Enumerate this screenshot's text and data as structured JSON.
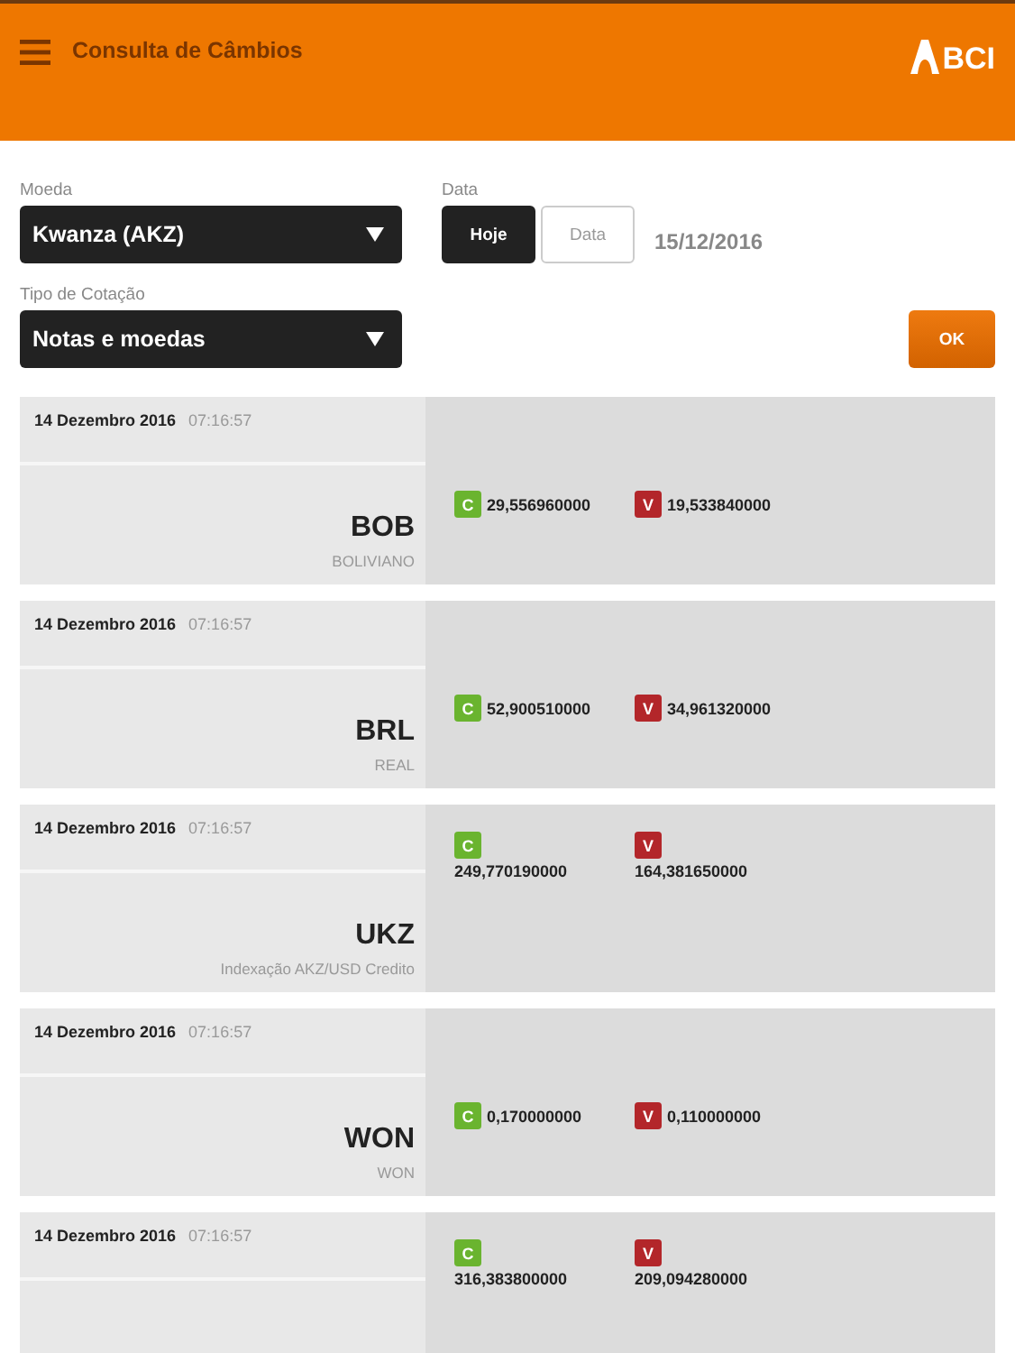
{
  "header": {
    "title": "Consulta de Câmbios",
    "logo": "BCI"
  },
  "form": {
    "currency": {
      "label": "Moeda",
      "value": "Kwanza (AKZ)"
    },
    "date": {
      "label": "Data",
      "options": [
        {
          "label": "Hoje",
          "selected": true
        },
        {
          "label": "Data",
          "selected": false
        }
      ],
      "value": "15/12/2016"
    },
    "quote_type": {
      "label": "Tipo de Cotação",
      "value": "Notas e moedas"
    },
    "ok_button": "OK"
  },
  "rates": [
    {
      "date": "14 Dezembro 2016",
      "time": "07:16:57",
      "code": "BOB",
      "name": "BOLIVIANO",
      "kind": "inline",
      "buy_badge": "C",
      "buy": "29,556960000",
      "sell_badge": "V",
      "sell": "19,533840000"
    },
    {
      "date": "14 Dezembro 2016",
      "time": "07:16:57",
      "code": "BRL",
      "name": "REAL",
      "kind": "inline",
      "buy_badge": "C",
      "buy": "52,900510000",
      "sell_badge": "V",
      "sell": "34,961320000"
    },
    {
      "date": "14 Dezembro 2016",
      "time": "07:16:57",
      "code": "UKZ",
      "name": "Indexação AKZ/USD Credito",
      "kind": "stacked",
      "buy_badge": "C",
      "buy": "249,770190000",
      "sell_badge": "V",
      "sell": "164,381650000"
    },
    {
      "date": "14 Dezembro 2016",
      "time": "07:16:57",
      "code": "WON",
      "name": "WON",
      "kind": "inline",
      "buy_badge": "C",
      "buy": "0,170000000",
      "sell_badge": "V",
      "sell": "0,110000000"
    },
    {
      "date": "14 Dezembro 2016",
      "time": "07:16:57",
      "kind": "stacked",
      "buy_badge": "C",
      "buy": "316,383800000",
      "sell_badge": "V",
      "sell": "209,094280000"
    }
  ]
}
